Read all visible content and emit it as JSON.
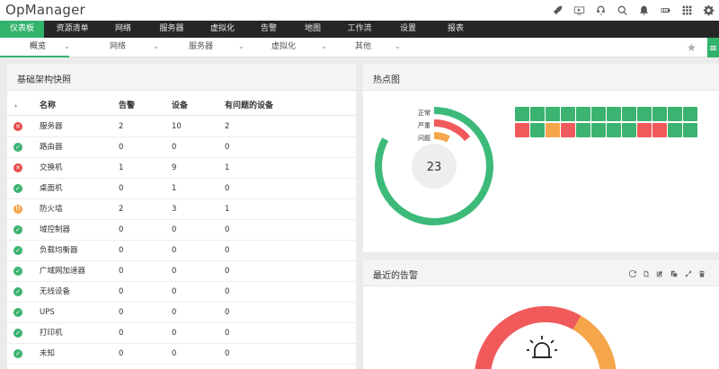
{
  "app": {
    "title": "OpManager"
  },
  "main_nav": [
    "仪表板",
    "资源清单",
    "网络",
    "服务器",
    "虚拟化",
    "告警",
    "地图",
    "工作流",
    "设置",
    "报表"
  ],
  "sub_nav": [
    "概览",
    "网络",
    "服务器",
    "虚拟化",
    "其他"
  ],
  "snapshot": {
    "title": "基础架构快照",
    "columns": [
      "名称",
      "告警",
      "设备",
      "有问题的设备"
    ],
    "rows": [
      {
        "status": "critical",
        "name": "服务器",
        "alarms": "2",
        "devices": "10",
        "problem": "2"
      },
      {
        "status": "ok",
        "name": "路由器",
        "alarms": "0",
        "devices": "0",
        "problem": "0"
      },
      {
        "status": "critical",
        "name": "交换机",
        "alarms": "1",
        "devices": "9",
        "problem": "1"
      },
      {
        "status": "ok",
        "name": "桌面机",
        "alarms": "0",
        "devices": "1",
        "problem": "0"
      },
      {
        "status": "warning",
        "name": "防火墙",
        "alarms": "2",
        "devices": "3",
        "problem": "1"
      },
      {
        "status": "ok",
        "name": "域控制器",
        "alarms": "0",
        "devices": "0",
        "problem": "0"
      },
      {
        "status": "ok",
        "name": "负载均衡器",
        "alarms": "0",
        "devices": "0",
        "problem": "0"
      },
      {
        "status": "ok",
        "name": "广域网加速器",
        "alarms": "0",
        "devices": "0",
        "problem": "0"
      },
      {
        "status": "ok",
        "name": "无线设备",
        "alarms": "0",
        "devices": "0",
        "problem": "0"
      },
      {
        "status": "ok",
        "name": "UPS",
        "alarms": "0",
        "devices": "0",
        "problem": "0"
      },
      {
        "status": "ok",
        "name": "打印机",
        "alarms": "0",
        "devices": "0",
        "problem": "0"
      },
      {
        "status": "ok",
        "name": "未知",
        "alarms": "0",
        "devices": "0",
        "problem": "0"
      }
    ]
  },
  "heatmap": {
    "title": "热点图",
    "total": "23",
    "legend": [
      "正常",
      "严重",
      "问题"
    ],
    "ring_fractions": {
      "normal": 0.83,
      "critical": 0.12,
      "trouble": 0.05
    },
    "cells": [
      "ok",
      "ok",
      "ok",
      "ok",
      "ok",
      "ok",
      "ok",
      "ok",
      "ok",
      "ok",
      "ok",
      "ok",
      "critical",
      "ok",
      "warn",
      "critical",
      "ok",
      "ok",
      "ok",
      "ok",
      "critical",
      "critical",
      "ok",
      "ok"
    ]
  },
  "recent_alarms": {
    "title": "最近的告警",
    "toolbar_icons": [
      "refresh-icon",
      "document-icon",
      "edit-icon",
      "copy-icon",
      "expand-icon",
      "delete-icon"
    ]
  },
  "colors": {
    "green": "#32b36b",
    "ok": "#3cb371",
    "critical": "#f05a5a",
    "warning": "#f5a54a",
    "nav_bg": "#262626"
  },
  "top_icons": [
    "rocket-icon",
    "media-icon",
    "headset-icon",
    "search-icon",
    "bell-icon",
    "battery-icon",
    "apps-grid-icon",
    "gear-icon"
  ]
}
